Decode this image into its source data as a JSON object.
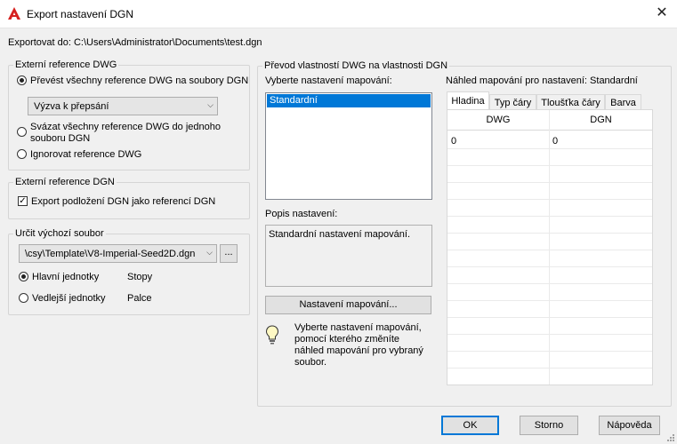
{
  "window": {
    "title": "Export nastavení DGN",
    "close_glyph": "✕"
  },
  "export_path": {
    "label": "Exportovat do: C:\\Users\\Administrator\\Documents\\test.dgn"
  },
  "xref_group": {
    "legend": "Externí reference DWG",
    "option1": "Převést všechny reference DWG na soubory DGN",
    "dropdown_value": "Výzva k přepsání",
    "option2_line1": "Svázat všechny reference DWG do jednoho",
    "option2_line2": "souboru DGN",
    "option3": "Ignorovat reference DWG",
    "selected": "option1"
  },
  "dgn_ref_group": {
    "legend": "Externí reference DGN",
    "checkbox_label": "Export podložení DGN jako referencí DGN",
    "checked": true
  },
  "seed_group": {
    "legend": "Určit výchozí soubor",
    "seed_value": "\\csy\\Template\\V8-Imperial-Seed2D.dgn",
    "browse_label": "...",
    "main_units_label": "Hlavní jednotky",
    "main_units_value": "Stopy",
    "sub_units_label": "Vedlejší jednotky",
    "sub_units_value": "Palce"
  },
  "mapping_group": {
    "legend": "Převod vlastností DWG na vlastnosti DGN",
    "select_label": "Vyberte nastavení mapování:",
    "setups": [
      "Standardní"
    ],
    "desc_label": "Popis nastavení:",
    "desc_text": "Standardní nastavení mapování.",
    "setup_button": "Nastavení mapování...",
    "tip_text": "Vyberte nastavení mapování, pomocí kterého změníte náhled mapování pro vybraný soubor.",
    "preview_label": "Náhled mapování pro nastavení: Standardní",
    "tabs": [
      "Hladina",
      "Typ čáry",
      "Tloušťka čáry",
      "Barva"
    ],
    "active_tab": "Hladina",
    "grid_headers": [
      "DWG",
      "DGN"
    ],
    "grid_rows": [
      [
        "0",
        "0"
      ]
    ]
  },
  "footer": {
    "ok": "OK",
    "cancel": "Storno",
    "help": "Nápověda"
  },
  "colors": {
    "accent": "#0078d7",
    "autocad_red": "#d6201f"
  }
}
